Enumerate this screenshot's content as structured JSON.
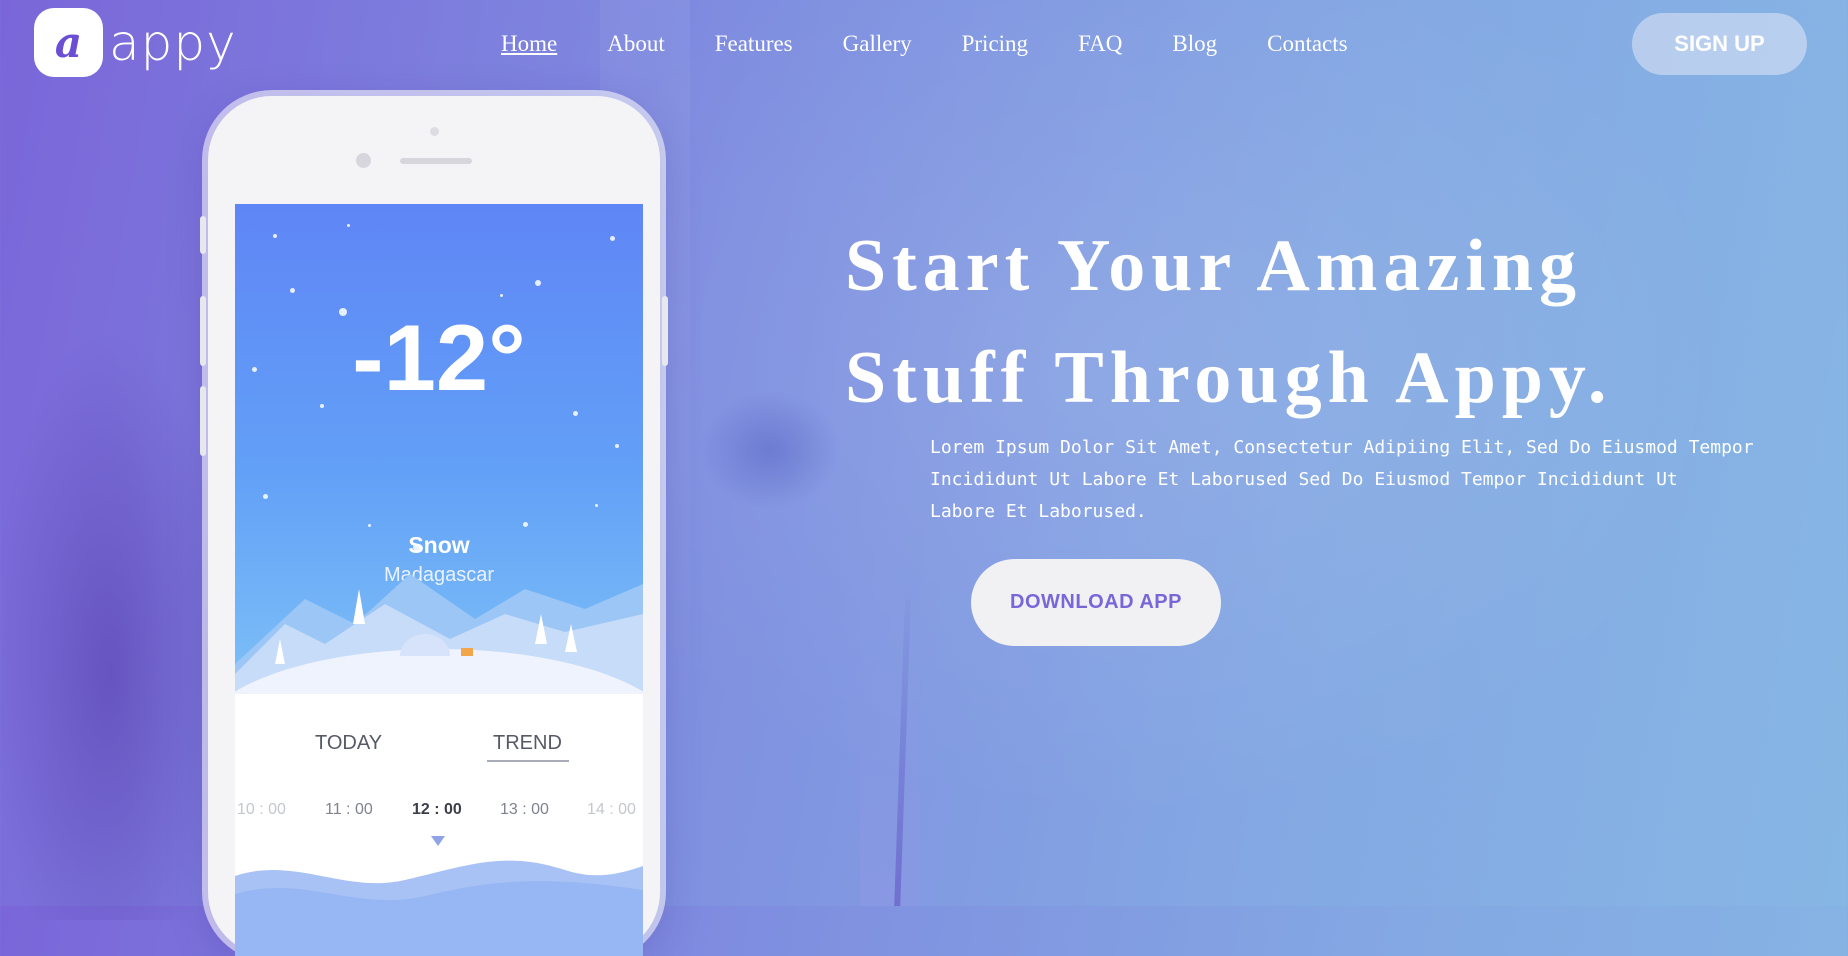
{
  "brand": {
    "mark": "a",
    "name": "appy"
  },
  "nav": {
    "items": [
      {
        "label": "Home",
        "active": true
      },
      {
        "label": "About"
      },
      {
        "label": "Features"
      },
      {
        "label": "Gallery"
      },
      {
        "label": "Pricing"
      },
      {
        "label": "FAQ"
      },
      {
        "label": "Blog"
      },
      {
        "label": "Contacts"
      }
    ],
    "signup_label": "SIGN UP"
  },
  "phone": {
    "temperature": "-12°",
    "condition": "Snow",
    "location": "Madagascar",
    "tabs": [
      "TODAY",
      "TREND"
    ],
    "selected_tab": "TREND",
    "times": [
      "10 : 00",
      "11 : 00",
      "12 : 00",
      "13 : 00",
      "14 : 00"
    ],
    "current_time": "12 : 00"
  },
  "hero": {
    "title_line1": "Start Your Amazing",
    "title_line2": "Stuff Through Appy.",
    "text_line1": "Lorem Ipsum Dolor Sit Amet, Consectetur Adipiing Elit, Sed Do Eiusmod Tempor",
    "text_line2": "Incididunt Ut Labore Et Laborused Sed Do Eiusmod Tempor Incididunt Ut",
    "text_line3": "Labore Et Laborused.",
    "cta_label": "DOWNLOAD APP"
  },
  "colors": {
    "accent": "#7a66d9",
    "background_start": "#7a66d9",
    "background_end": "#86b6e4",
    "sky_top": "#5f86f6",
    "button_light": "#f1f1f3"
  }
}
